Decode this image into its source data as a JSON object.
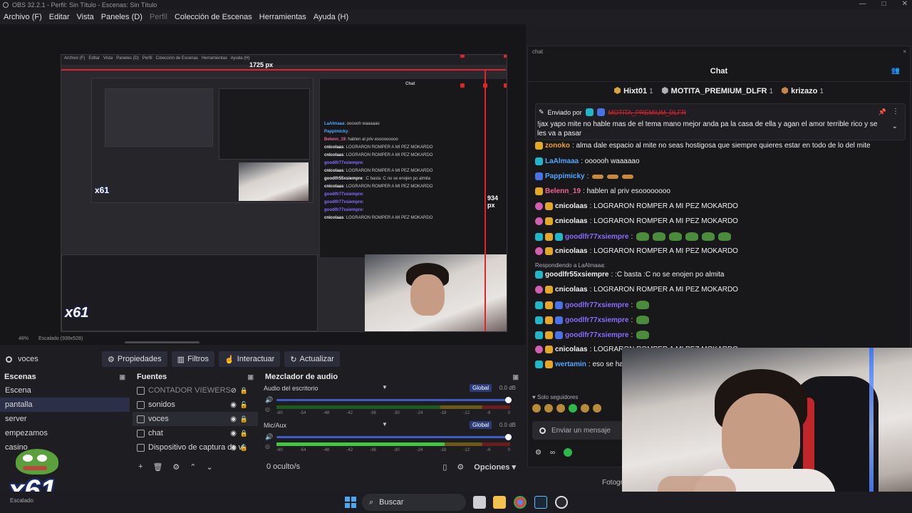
{
  "window": {
    "title": "OBS 32.2.1 - Perfil: Sin Título - Escenas: Sin Título"
  },
  "menu": [
    {
      "label": "Archivo (F)",
      "dim": false
    },
    {
      "label": "Editar",
      "dim": false
    },
    {
      "label": "Vista",
      "dim": false
    },
    {
      "label": "Paneles (D)",
      "dim": false
    },
    {
      "label": "Perfil",
      "dim": true
    },
    {
      "label": "Colección de Escenas",
      "dim": false
    },
    {
      "label": "Herramientas",
      "dim": false
    },
    {
      "label": "Ayuda (H)",
      "dim": false
    }
  ],
  "preview": {
    "width_label": "1725 px",
    "height_label": "934 px",
    "inner_width_label": "1725 px",
    "inner_height_label": "934 px",
    "zoom": "48%",
    "scaled": "Escalado (939x528)",
    "nested_logo": "x61"
  },
  "source_toolbar": {
    "current_source": "voces",
    "properties": "Propiedades",
    "filters": "Filtros",
    "interact": "Interactuar",
    "refresh": "Actualizar"
  },
  "scenes": {
    "title": "Escenas",
    "items": [
      "Escena",
      "pantalla",
      "server",
      "empezamos",
      "casino"
    ],
    "selected": 1
  },
  "sources": {
    "title": "Fuentes",
    "items": [
      {
        "label": "CONTADOR VIEWERS",
        "hidden": true,
        "locked": true
      },
      {
        "label": "sonidos",
        "hidden": false,
        "locked": false
      },
      {
        "label": "voces",
        "hidden": false,
        "locked": true
      },
      {
        "label": "chat",
        "hidden": false,
        "locked": true
      },
      {
        "label": "Dispositivo de captura de vi",
        "hidden": false,
        "locked": true
      }
    ],
    "selected": 2
  },
  "mixer": {
    "title": "Mezclador de audio",
    "channels": [
      {
        "label": "Audio del escritorio",
        "global": "Global",
        "db": "0.0 dB",
        "level": 0.0
      },
      {
        "label": "Mic/Aux",
        "global": "Global",
        "db": "0.0 dB",
        "level": 0.72
      }
    ],
    "ticks": [
      "-60",
      "-54",
      "-48",
      "-42",
      "-36",
      "-30",
      "-24",
      "-18",
      "-12",
      "-6",
      "0"
    ],
    "hidden_count": "0 oculto/s",
    "options": "Opciones"
  },
  "chat": {
    "tab": "chat",
    "title": "Chat",
    "leaders": [
      {
        "name": "Hixt01",
        "rank": "1"
      },
      {
        "name": "MOTITA_PREMIUM_DLFR",
        "rank": "1"
      },
      {
        "name": "krizazo",
        "rank": "1"
      }
    ],
    "pinned": {
      "by_label": "Enviado por",
      "user": "MOTITA_PREMIUM_DLFR",
      "text": "!jax yapo mite no hable mas de el tema mano mejor anda pa la casa de ella y agan el amor terrible rico y se les va a pasar"
    },
    "messages": [
      {
        "user": "zonoko",
        "color": "#f0a020",
        "text": ": alma dale espacio al mite no seas hostigosa que siempre quieres estar en todo de lo del mite",
        "emotes": 0
      },
      {
        "user": "LaAlmaaa",
        "color": "#4fa8ff",
        "text": ": oooooh waaaaao",
        "emotes": 0
      },
      {
        "user": "Pappimicky",
        "color": "#4fa8ff",
        "text": ": ",
        "emotes": 3,
        "burger": true
      },
      {
        "user": "Belenn_19",
        "color": "#f06292",
        "text": ": hablen al priv esoooooooo",
        "emotes": 0
      },
      {
        "user": "cnicolaas",
        "color": "#efeff1",
        "text": ": LOGRARON ROMPER A MI PEZ MOKARDO",
        "emotes": 0
      },
      {
        "user": "cnicolaas",
        "color": "#efeff1",
        "text": ": LOGRARON ROMPER A MI PEZ MOKARDO",
        "emotes": 0
      },
      {
        "user": "goodlfr77xsiempre",
        "color": "#8a6cff",
        "text": ": ",
        "emotes": 6
      },
      {
        "user": "cnicolaas",
        "color": "#efeff1",
        "text": ": LOGRARON ROMPER A MI PEZ MOKARDO",
        "emotes": 0
      },
      {
        "user": "goodlfr55xsiempre",
        "color": "#efeff1",
        "text": ": :C basta :C no se enojen po almita",
        "emotes": 0,
        "reply": "Respondiendo a LaAlmaaa:"
      },
      {
        "user": "cnicolaas",
        "color": "#efeff1",
        "text": ": LOGRARON ROMPER A MI PEZ MOKARDO",
        "emotes": 0
      },
      {
        "user": "goodlfr77xsiempre",
        "color": "#8a6cff",
        "text": ": ",
        "emotes": 1
      },
      {
        "user": "goodlfr77xsiempre",
        "color": "#8a6cff",
        "text": ": ",
        "emotes": 1
      },
      {
        "user": "goodlfr77xsiempre",
        "color": "#8a6cff",
        "text": ": ",
        "emotes": 1
      },
      {
        "user": "cnicolaas",
        "color": "#efeff1",
        "text": ": LOGRARON ROMPER A MI PEZ MOKARDO",
        "emotes": 0
      },
      {
        "user": "wertamin",
        "color": "#4fa8ff",
        "text": ": eso se habla y después se chupa ano",
        "emotes": 0
      }
    ],
    "followers_only": "Solo seguidores",
    "input_placeholder": "Enviar un mensaje"
  },
  "statusbar": {
    "foto": "Fotogr",
    "notif": "Escalado"
  },
  "overlay": {
    "logo_text": "x61"
  },
  "taskbar": {
    "search": "Buscar"
  },
  "colors": {
    "accent": "#2c3c7a",
    "measure": "#e0242b",
    "chat_bg": "#18181b"
  }
}
